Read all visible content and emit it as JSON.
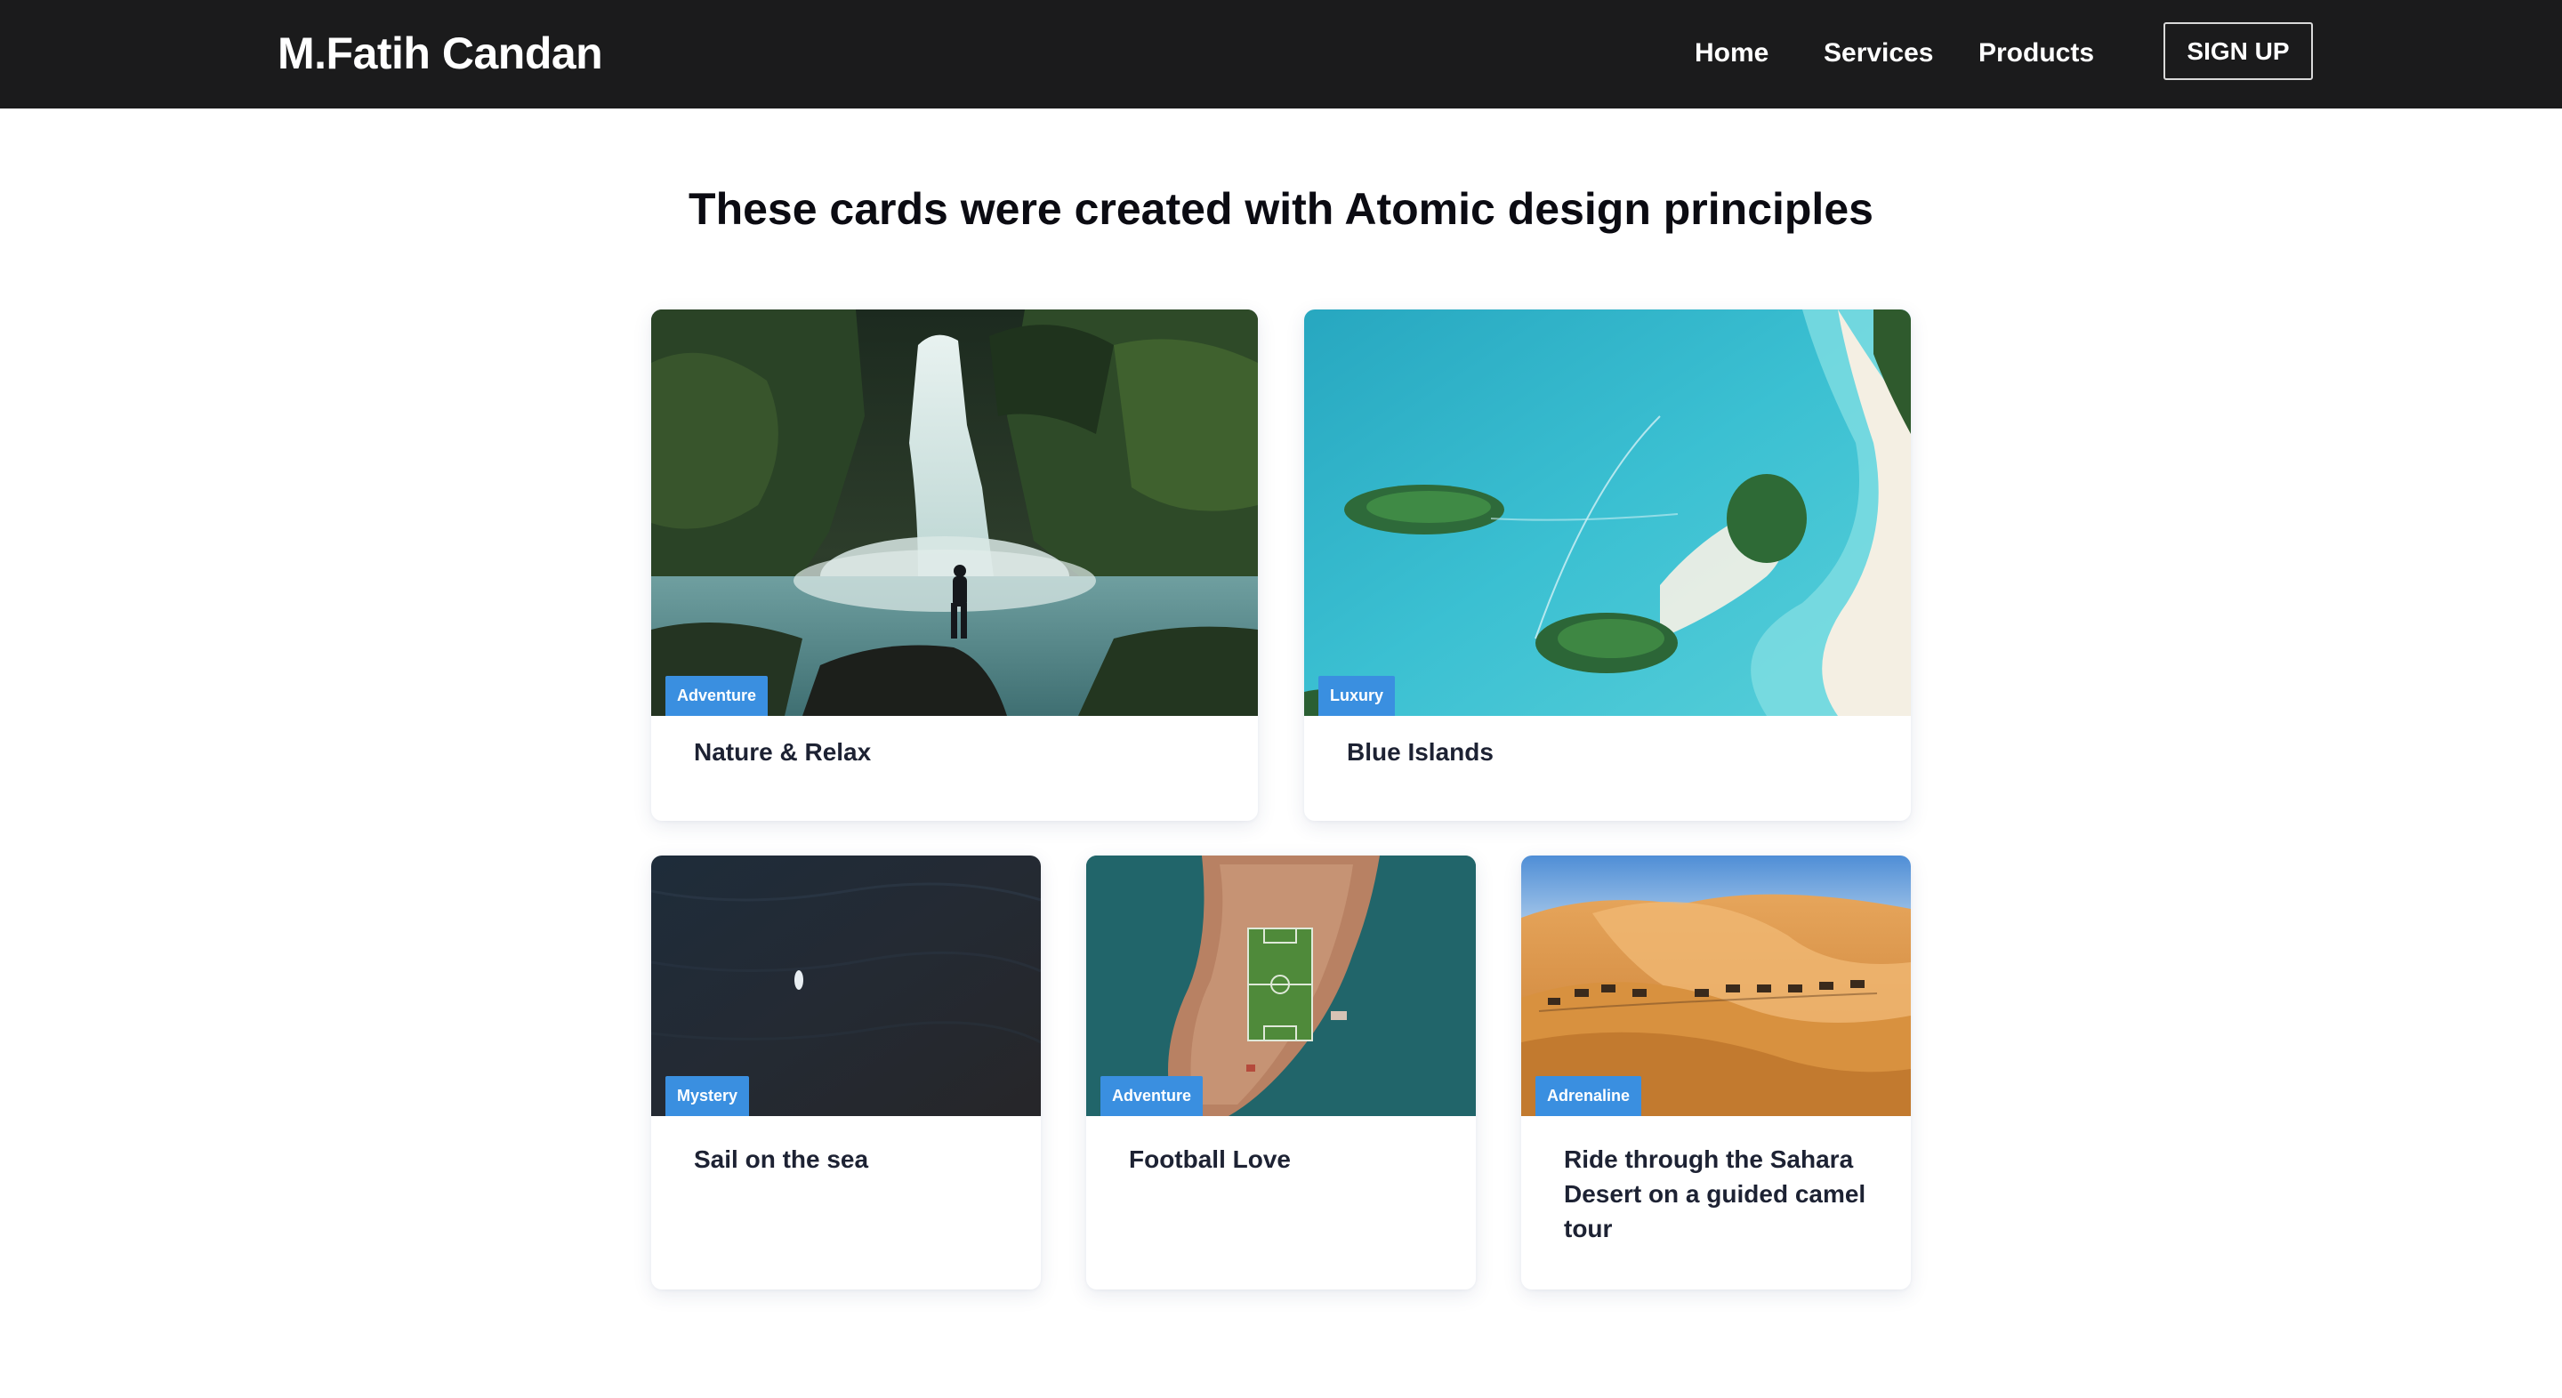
{
  "navbar": {
    "brand": "M.Fatih Candan",
    "links": [
      {
        "label": "Home"
      },
      {
        "label": "Services"
      },
      {
        "label": "Products"
      }
    ],
    "signup_label": "SIGN UP"
  },
  "page": {
    "title": "These cards were created with Atomic design principles"
  },
  "cards": [
    {
      "title": "Nature & Relax",
      "badge": "Adventure",
      "image": "waterfall-photo"
    },
    {
      "title": "Blue Islands",
      "badge": "Luxury",
      "image": "aerial-islands-photo"
    },
    {
      "title": "Sail on the sea",
      "badge": "Mystery",
      "image": "sea-boat-photo"
    },
    {
      "title": "Football Love",
      "badge": "Adventure",
      "image": "island-football-pitch-photo"
    },
    {
      "title": "Ride through the Sahara Desert on a guided camel tour",
      "badge": "Adrenaline",
      "image": "desert-camels-photo"
    }
  ],
  "colors": {
    "navbar_bg": "#1b1b1c",
    "badge_bg": "#3a8fe0",
    "title_text": "#1d2233"
  }
}
